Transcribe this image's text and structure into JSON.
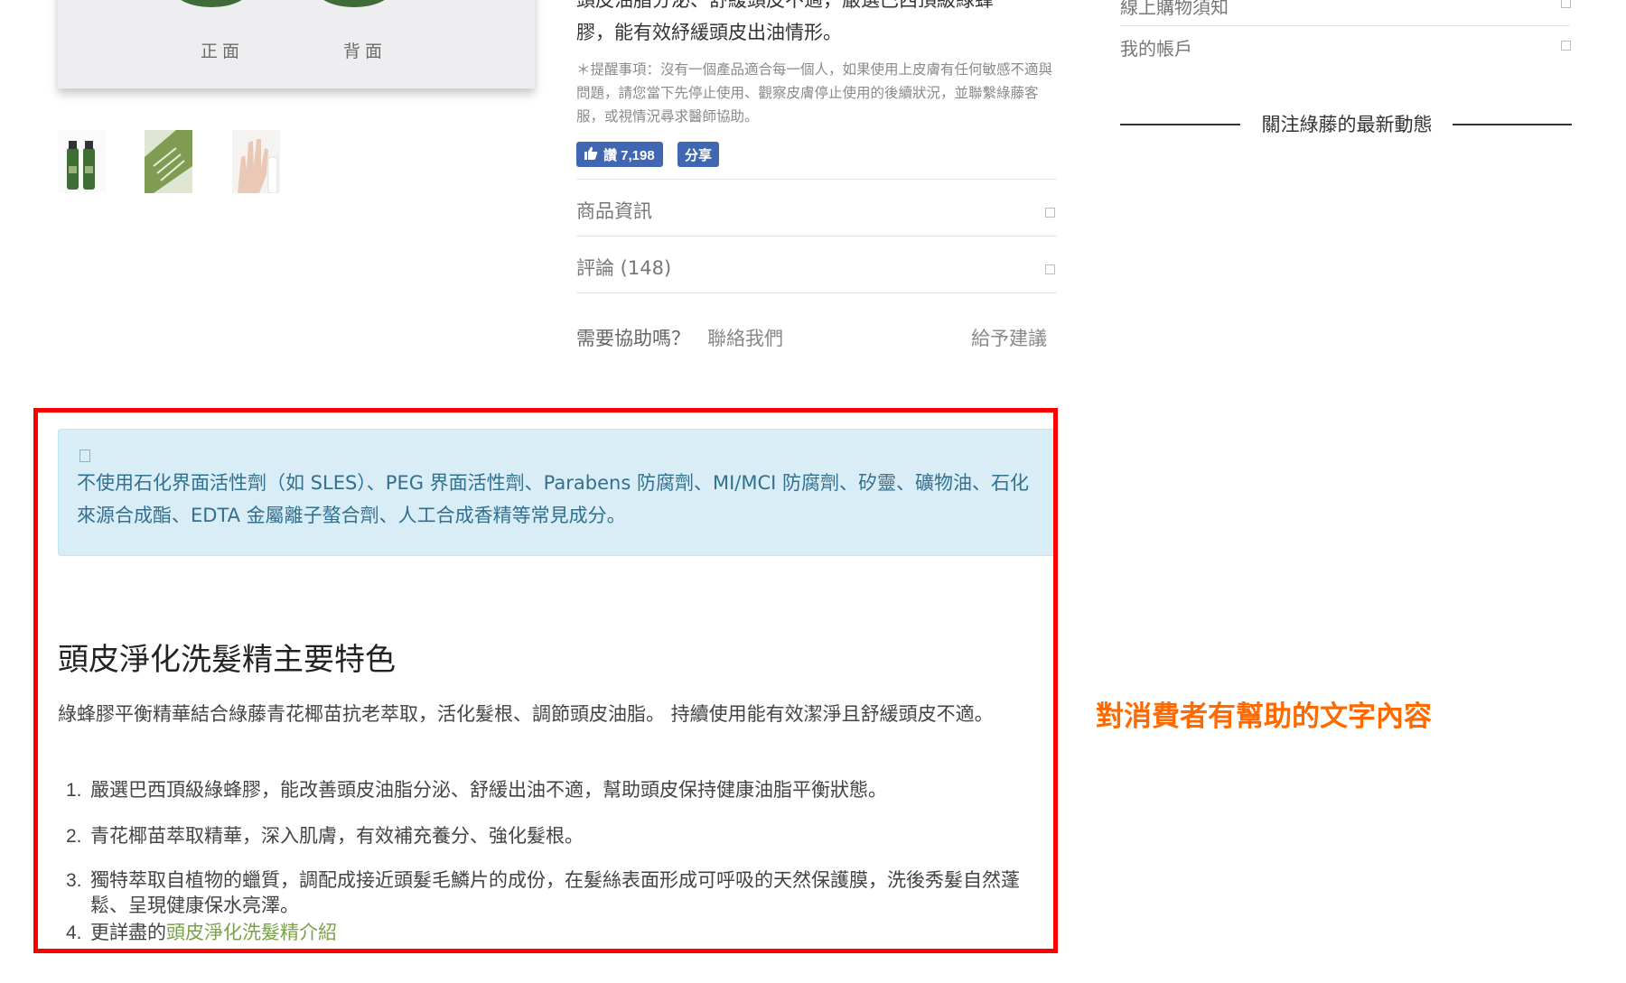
{
  "product_images": {
    "captions": [
      "正面",
      "背面"
    ]
  },
  "description": {
    "text_line1": "頭皮油脂分泌、舒緩頭皮不適，嚴選巴西頂級綠蜂",
    "text_line2": "膠，能有效紓緩頭皮出油情形。",
    "reminder": "＊提醒事項：沒有一個產品適合每一個人，如果使用上皮膚有任何敏感不適與問題，請您當下先停止使用、觀察皮膚停止使用的後續狀況，並聯繫綠藤客服，或視情況尋求醫師協助。"
  },
  "social": {
    "like_label": "讚 7,198",
    "share_label": "分享"
  },
  "accordion": [
    {
      "label": "商品資訊"
    },
    {
      "label": "評論 (148)"
    }
  ],
  "help": {
    "question": "需要協助嗎？",
    "contact_label": "聯絡我們",
    "suggest_label": "給予建議"
  },
  "sidebar": {
    "items": [
      {
        "label": "線上購物須知"
      },
      {
        "label": "我的帳戶"
      }
    ],
    "follow_title": "關注綠藤的最新動態"
  },
  "notice": {
    "text": "不使用石化界面活性劑（如 SLES）、PEG 界面活性劑、Parabens 防腐劑、MI/MCI 防腐劑、矽靈、礦物油、石化來源合成酯、EDTA 金屬離子螯合劑、人工合成香精等常見成分。"
  },
  "features": {
    "heading": "頭皮淨化洗髮精主要特色",
    "intro": "綠蜂膠平衡精華結合綠藤青花椰苗抗老萃取，活化髮根、調節頭皮油脂。 持續使用能有效潔淨且舒緩頭皮不適。",
    "items": [
      {
        "num": "1.",
        "text": "嚴選巴西頂級綠蜂膠，能改善頭皮油脂分泌、舒緩出油不適，幫助頭皮保持健康油脂平衡狀態。"
      },
      {
        "num": "2.",
        "text": "青花椰苗萃取精華，深入肌膚，有效補充養分、強化髮根。"
      },
      {
        "num": "3.",
        "text": "獨特萃取自植物的蠟質，調配成接近頭髮毛鱗片的成份，在髮絲表面形成可呼吸的天然保護膜，洗後秀髮自然蓬鬆、呈現健康保水亮澤。"
      },
      {
        "num": "4.",
        "text_prefix": "更詳盡的",
        "link_label": "頭皮淨化洗髮精介紹"
      }
    ]
  },
  "annotation": {
    "text": "對消費者有幫助的文字內容"
  },
  "colors": {
    "highlight_border": "#ff0000",
    "annotation": "#ff6a00",
    "alert_bg": "#d9edf7",
    "alert_text": "#31708f",
    "link_green": "#7aa14a",
    "facebook_blue": "#4267b2"
  },
  "icons": [
    "thumbs-up-icon",
    "chevron-down-icon",
    "info-icon"
  ]
}
